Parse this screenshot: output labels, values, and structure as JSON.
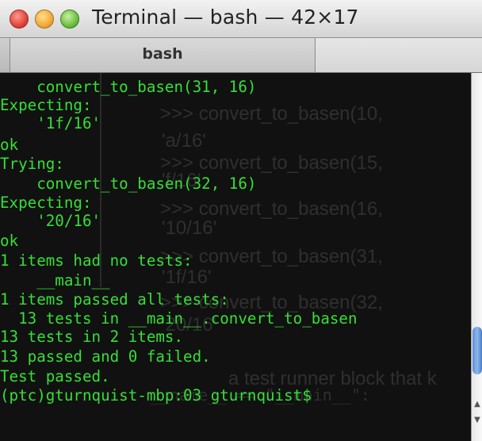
{
  "window": {
    "title": "Terminal — bash — 42×17"
  },
  "tabs": [
    {
      "label": "bash"
    }
  ],
  "terminal": {
    "lines": [
      "    convert_to_basen(31, 16)",
      "Expecting:",
      "    '1f/16'",
      "ok",
      "Trying:",
      "    convert_to_basen(32, 16)",
      "Expecting:",
      "    '20/16'",
      "ok",
      "1 items had no tests:",
      "    __main__",
      "1 items passed all tests:",
      "  13 tests in __main__.convert_to_basen",
      "13 tests in 2 items.",
      "13 passed and 0 failed.",
      "Test passed.",
      "(ptc)gturnquist-mbp:03 gturnquist$"
    ],
    "background_text": [
      ">>> convert_to_basen(10,",
      "'a/16'",
      ">>> convert_to_basen(15,",
      "'f/16'",
      ">>> convert_to_basen(16,",
      "'10/16'",
      ">>> convert_to_basen(31,",
      "'1f/16'",
      ">>> convert_to_basen(32,",
      "'20/16'",
      "a test runner block that k",
      "__name__ == \"__main__\":"
    ]
  },
  "colors": {
    "text": "#35e035",
    "background": "#111111"
  }
}
